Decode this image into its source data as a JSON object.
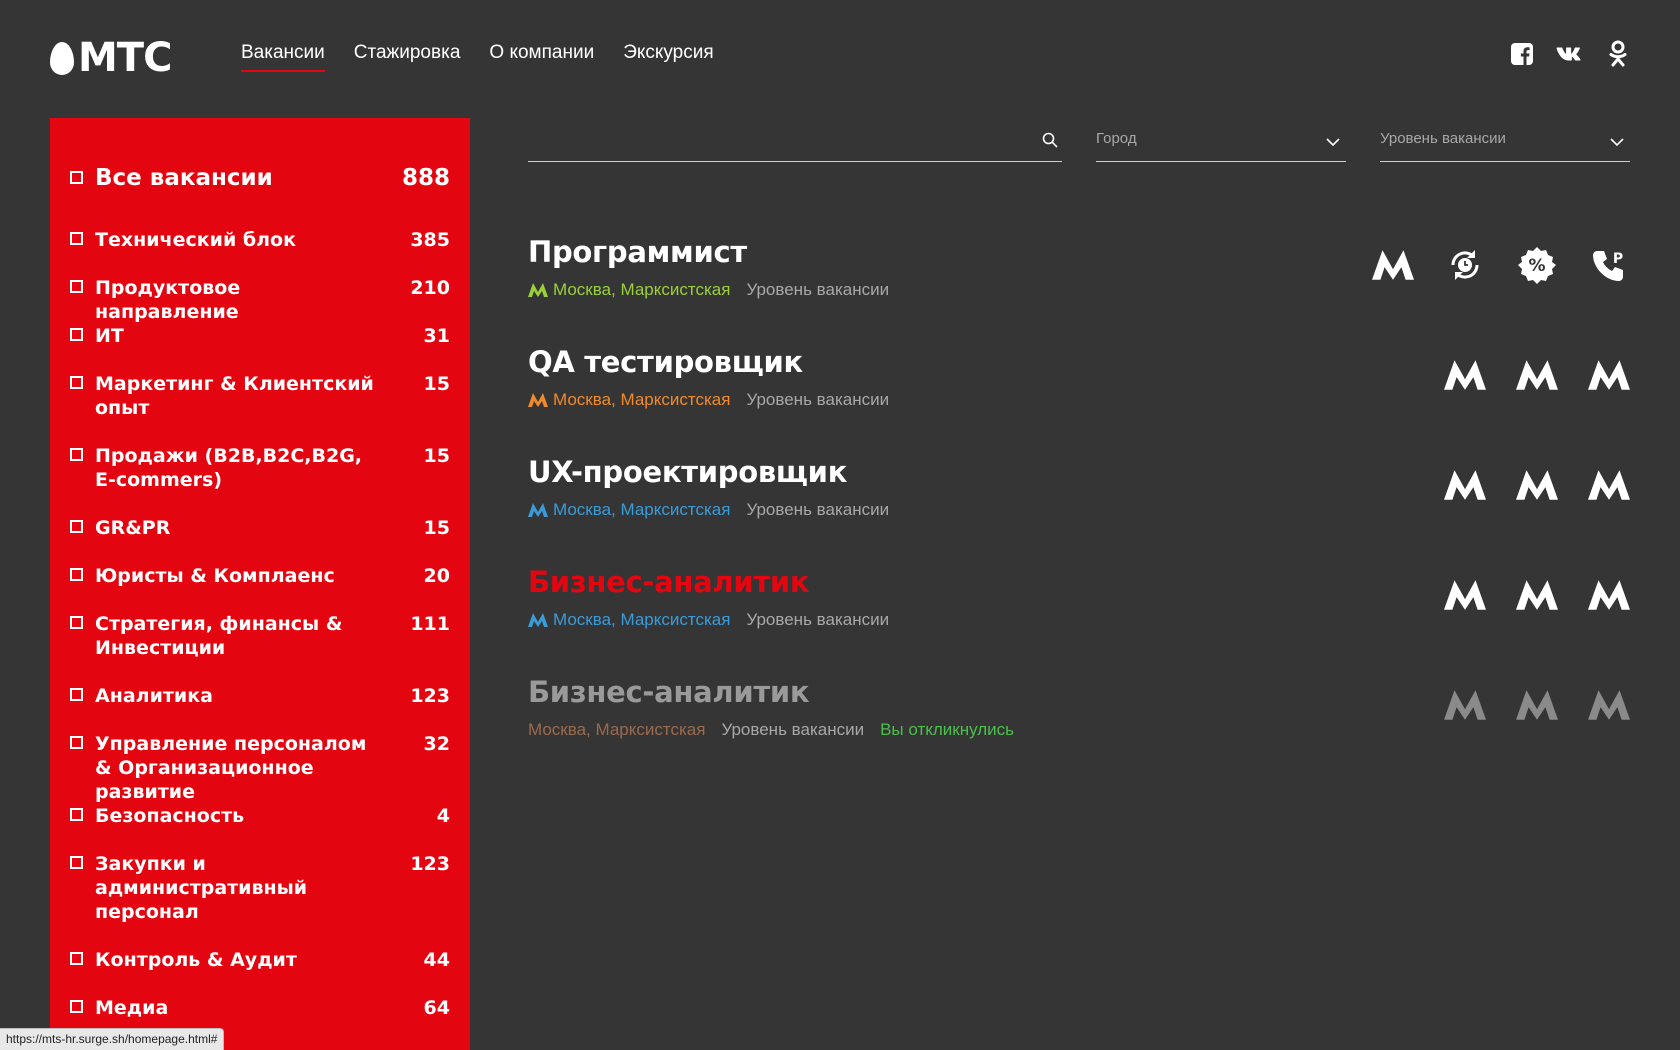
{
  "header": {
    "logo_text": "МТС",
    "nav": [
      {
        "label": "Вакансии",
        "active": true
      },
      {
        "label": "Стажировка",
        "active": false
      },
      {
        "label": "О компании",
        "active": false
      },
      {
        "label": "Экскурсия",
        "active": false
      }
    ],
    "social_icons": [
      "facebook-icon",
      "vk-icon",
      "odnoklassniki-icon"
    ]
  },
  "sidebar": {
    "categories": [
      {
        "label": "Все вакансии",
        "count": "888"
      },
      {
        "label": "Технический блок",
        "count": "385"
      },
      {
        "label": "Продуктовое направление",
        "count": "210"
      },
      {
        "label": "ИТ",
        "count": "31"
      },
      {
        "label": "Маркетинг & Клиентский опыт",
        "count": "15"
      },
      {
        "label": "Продажи (B2B,B2C,B2G, E-commers)",
        "count": "15"
      },
      {
        "label": "GR&PR",
        "count": "15"
      },
      {
        "label": "Юристы & Комплаенс",
        "count": "20"
      },
      {
        "label": "Стратегия, финансы & Инвестиции",
        "count": "111"
      },
      {
        "label": "Аналитика",
        "count": "123"
      },
      {
        "label": "Управление персоналом & Организационное развитие",
        "count": "32"
      },
      {
        "label": "Безопасность",
        "count": "4"
      },
      {
        "label": "Закупки и административный персонал",
        "count": "123"
      },
      {
        "label": "Контроль & Аудит",
        "count": "44"
      },
      {
        "label": "Медиа",
        "count": "64"
      }
    ]
  },
  "filters": {
    "search_value": "",
    "city_placeholder": "Город",
    "level_placeholder": "Уровень вакансии"
  },
  "vacancies": [
    {
      "title": "Программист",
      "location": "Москва, Марксистская",
      "level": "Уровень вакансии",
      "status": "",
      "icons": [
        "metro-icon",
        "clock-refresh-icon",
        "percent-badge-icon",
        "phone-parking-icon"
      ]
    },
    {
      "title": "QA тестировщик",
      "location": "Москва, Марксистская",
      "level": "Уровень вакансии",
      "status": "",
      "icons": [
        "metro-icon",
        "metro-icon",
        "metro-icon"
      ]
    },
    {
      "title": "UX-проектировщик",
      "location": "Москва, Марксистская",
      "level": "Уровень вакансии",
      "status": "",
      "icons": [
        "metro-icon",
        "metro-icon",
        "metro-icon"
      ]
    },
    {
      "title": "Бизнес-аналитик",
      "location": "Москва, Марксистская",
      "level": "Уровень вакансии",
      "status": "",
      "icons": [
        "metro-icon",
        "metro-icon",
        "metro-icon"
      ]
    },
    {
      "title": "Бизнес-аналитик",
      "location": "Москва, Марксистская",
      "level": "Уровень вакансии",
      "status": "Вы откликнулись",
      "icons": [
        "metro-icon",
        "metro-icon",
        "metro-icon"
      ]
    }
  ],
  "status_bar": "https://mts-hr.surge.sh/homepage.html#",
  "colors": {
    "background": "#353535",
    "brand_red": "#e30611",
    "metro_green": "#9ad03a",
    "metro_orange": "#f08a2b",
    "metro_blue": "#3a9bd9",
    "applied_green": "#4cbf4c",
    "muted_brown": "#9a6a4e"
  }
}
